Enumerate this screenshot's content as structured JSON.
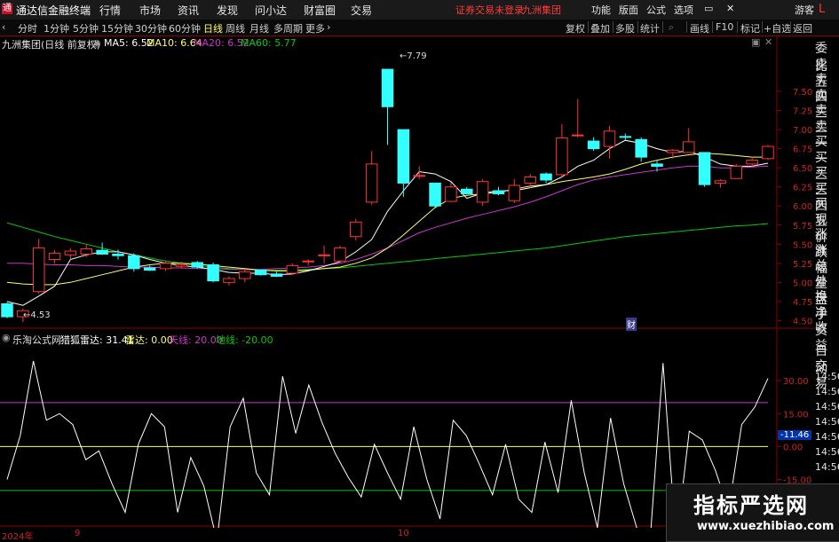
{
  "menubar": {
    "brand": "通达信金融终端",
    "items": [
      "行情",
      "市场",
      "资讯",
      "发现",
      "问小达",
      "财富圈",
      "交易"
    ],
    "login_status": "证券交易未登录",
    "group_name": "九洲集团",
    "right_items": [
      "功能",
      "版面",
      "公式",
      "选项"
    ],
    "guest": "游客"
  },
  "toolbar": {
    "periods": [
      "分时",
      "1分钟",
      "5分钟",
      "15分钟",
      "30分钟",
      "60分钟",
      "日线",
      "周线",
      "月线",
      "多周期",
      "更多"
    ],
    "active": "日线",
    "right_items": [
      "复权",
      "叠加",
      "多股",
      "统计",
      "画线",
      "F10",
      "标记",
      "+自选",
      "返回"
    ]
  },
  "infobar": {
    "stock": "九洲集团(日线 前复权)",
    "ma5": "MA5: 6.52",
    "ma10": "MA10: 6.64",
    "ma20": "MA20: 6.52",
    "ma60": "MA60: 5.77"
  },
  "indicator_bar": {
    "source": "乐淘公式网",
    "name": "猎狐雷达: 31.41",
    "radar": "雷达: 0.00",
    "sky": "天线: 20.00",
    "ground": "地线: -20.00"
  },
  "right_panel": [
    "委比",
    "卖五",
    "卖四",
    "卖三",
    "卖二",
    "卖一",
    "买一",
    "买二",
    "买三",
    "买四",
    "买五",
    "现价",
    "涨跌",
    "涨幅",
    "总量",
    "外盘",
    "换手",
    "净资",
    "收益"
  ],
  "right_panel2": [
    "自动",
    "交易"
  ],
  "right_times": [
    "14:56",
    "14:56",
    "14:56",
    "14:56",
    "14:56",
    "14:56",
    "14:56"
  ],
  "corner_label": "L",
  "price_annotations": {
    "high": "7.79",
    "low": "4.53",
    "cai": "财"
  },
  "x_labels": [
    "2024年",
    "9",
    "10"
  ],
  "watermark": {
    "title": "指标严选网",
    "url": "www.xuezhibiao.com"
  },
  "chart_data": {
    "type": "candlestick",
    "price_axis": {
      "ticks": [
        "7.50",
        "7.25",
        "7.00",
        "6.75",
        "6.50",
        "6.25",
        "6.00",
        "5.75",
        "5.50",
        "5.25",
        "5.00",
        "4.75",
        "4.50"
      ],
      "range": [
        4.4,
        8.0
      ]
    },
    "indicator_axis": {
      "ticks": [
        "30.00",
        "15.00",
        "0.00",
        "-15.00",
        "-30.00"
      ],
      "range": [
        -35,
        45
      ],
      "current": "-11.46",
      "sky": 20,
      "ground": -20,
      "radar": 0
    },
    "colors": {
      "up": "#ff3333",
      "down": "#33ffff",
      "ma5": "#ffffff",
      "ma10": "#ffff66",
      "ma20": "#cc33cc",
      "ma60": "#00cc00"
    },
    "candles": [
      {
        "o": 4.72,
        "h": 4.74,
        "l": 4.53,
        "c": 4.55
      },
      {
        "o": 4.55,
        "h": 4.66,
        "l": 4.48,
        "c": 4.63
      },
      {
        "o": 4.88,
        "h": 5.57,
        "l": 4.85,
        "c": 5.45
      },
      {
        "o": 5.3,
        "h": 5.42,
        "l": 5.25,
        "c": 5.38
      },
      {
        "o": 5.36,
        "h": 5.45,
        "l": 5.3,
        "c": 5.41
      },
      {
        "o": 5.37,
        "h": 5.5,
        "l": 5.33,
        "c": 5.44
      },
      {
        "o": 5.42,
        "h": 5.52,
        "l": 5.36,
        "c": 5.37
      },
      {
        "o": 5.37,
        "h": 5.43,
        "l": 5.3,
        "c": 5.35
      },
      {
        "o": 5.35,
        "h": 5.38,
        "l": 5.14,
        "c": 5.18
      },
      {
        "o": 5.19,
        "h": 5.22,
        "l": 5.15,
        "c": 5.16
      },
      {
        "o": 5.18,
        "h": 5.28,
        "l": 5.15,
        "c": 5.25
      },
      {
        "o": 5.21,
        "h": 5.27,
        "l": 5.18,
        "c": 5.23
      },
      {
        "o": 5.26,
        "h": 5.28,
        "l": 5.18,
        "c": 5.2
      },
      {
        "o": 5.23,
        "h": 5.26,
        "l": 5.0,
        "c": 5.02
      },
      {
        "o": 5.0,
        "h": 5.08,
        "l": 4.96,
        "c": 5.05
      },
      {
        "o": 5.05,
        "h": 5.18,
        "l": 5.0,
        "c": 5.14
      },
      {
        "o": 5.16,
        "h": 5.17,
        "l": 5.09,
        "c": 5.1
      },
      {
        "o": 5.11,
        "h": 5.14,
        "l": 5.07,
        "c": 5.08
      },
      {
        "o": 5.12,
        "h": 5.25,
        "l": 5.1,
        "c": 5.22
      },
      {
        "o": 5.27,
        "h": 5.3,
        "l": 5.22,
        "c": 5.28
      },
      {
        "o": 5.36,
        "h": 5.48,
        "l": 5.25,
        "c": 5.36
      },
      {
        "o": 5.28,
        "h": 5.48,
        "l": 5.27,
        "c": 5.45
      },
      {
        "o": 5.6,
        "h": 5.83,
        "l": 5.55,
        "c": 5.79
      },
      {
        "o": 6.05,
        "h": 6.72,
        "l": 6.02,
        "c": 6.55
      },
      {
        "o": 7.79,
        "h": 7.79,
        "l": 6.8,
        "c": 7.3
      },
      {
        "o": 7.0,
        "h": 7.0,
        "l": 6.12,
        "c": 6.3
      },
      {
        "o": 6.4,
        "h": 6.52,
        "l": 6.35,
        "c": 6.4
      },
      {
        "o": 6.3,
        "h": 6.3,
        "l": 5.97,
        "c": 6.0
      },
      {
        "o": 6.06,
        "h": 6.31,
        "l": 6.05,
        "c": 6.25
      },
      {
        "o": 6.22,
        "h": 6.25,
        "l": 6.15,
        "c": 6.16
      },
      {
        "o": 6.05,
        "h": 6.35,
        "l": 6.0,
        "c": 6.32
      },
      {
        "o": 6.2,
        "h": 6.25,
        "l": 6.14,
        "c": 6.16
      },
      {
        "o": 6.07,
        "h": 6.35,
        "l": 6.04,
        "c": 6.27
      },
      {
        "o": 6.3,
        "h": 6.42,
        "l": 6.24,
        "c": 6.38
      },
      {
        "o": 6.42,
        "h": 6.44,
        "l": 6.3,
        "c": 6.34
      },
      {
        "o": 6.41,
        "h": 7.07,
        "l": 6.38,
        "c": 6.89
      },
      {
        "o": 6.93,
        "h": 7.4,
        "l": 6.9,
        "c": 6.93
      },
      {
        "o": 6.85,
        "h": 6.9,
        "l": 6.72,
        "c": 6.75
      },
      {
        "o": 6.78,
        "h": 7.05,
        "l": 6.62,
        "c": 6.98
      },
      {
        "o": 6.91,
        "h": 6.95,
        "l": 6.86,
        "c": 6.9
      },
      {
        "o": 6.87,
        "h": 6.9,
        "l": 6.58,
        "c": 6.64
      },
      {
        "o": 6.55,
        "h": 6.59,
        "l": 6.45,
        "c": 6.52
      },
      {
        "o": 6.7,
        "h": 6.75,
        "l": 6.62,
        "c": 6.73
      },
      {
        "o": 6.7,
        "h": 7.02,
        "l": 6.7,
        "c": 6.84
      },
      {
        "o": 6.7,
        "h": 6.7,
        "l": 6.25,
        "c": 6.28
      },
      {
        "o": 6.3,
        "h": 6.35,
        "l": 6.24,
        "c": 6.33
      },
      {
        "o": 6.36,
        "h": 6.55,
        "l": 6.35,
        "c": 6.52
      },
      {
        "o": 6.55,
        "h": 6.65,
        "l": 6.5,
        "c": 6.6
      },
      {
        "o": 6.62,
        "h": 6.8,
        "l": 6.6,
        "c": 6.78
      }
    ],
    "ma5": [
      4.75,
      4.7,
      4.82,
      4.95,
      5.3,
      5.36,
      5.4,
      5.4,
      5.36,
      5.3,
      5.25,
      5.22,
      5.2,
      5.17,
      5.13,
      5.12,
      5.12,
      5.1,
      5.11,
      5.15,
      5.21,
      5.27,
      5.4,
      5.56,
      5.93,
      6.2,
      6.45,
      6.42,
      6.32,
      6.1,
      6.17,
      6.2,
      6.2,
      6.24,
      6.28,
      6.38,
      6.52,
      6.6,
      6.75,
      6.86,
      6.82,
      6.75,
      6.7,
      6.72,
      6.64,
      6.55,
      6.52,
      6.52,
      6.56
    ],
    "ma10": [
      5.0,
      4.98,
      4.97,
      4.97,
      5.0,
      5.05,
      5.1,
      5.15,
      5.2,
      5.23,
      5.25,
      5.25,
      5.24,
      5.22,
      5.2,
      5.18,
      5.16,
      5.15,
      5.15,
      5.16,
      5.18,
      5.2,
      5.25,
      5.32,
      5.45,
      5.62,
      5.8,
      5.98,
      6.1,
      6.14,
      6.16,
      6.18,
      6.22,
      6.26,
      6.28,
      6.32,
      6.35,
      6.38,
      6.42,
      6.48,
      6.55,
      6.6,
      6.64,
      6.67,
      6.69,
      6.68,
      6.66,
      6.64,
      6.64
    ],
    "ma20": [
      5.25,
      5.25,
      5.24,
      5.23,
      5.23,
      5.22,
      5.22,
      5.21,
      5.2,
      5.2,
      5.19,
      5.19,
      5.18,
      5.18,
      5.17,
      5.17,
      5.17,
      5.18,
      5.19,
      5.2,
      5.22,
      5.25,
      5.3,
      5.37,
      5.45,
      5.55,
      5.65,
      5.72,
      5.78,
      5.84,
      5.89,
      5.94,
      5.99,
      6.05,
      6.12,
      6.2,
      6.28,
      6.34,
      6.38,
      6.41,
      6.44,
      6.47,
      6.5,
      6.52,
      6.52,
      6.5,
      6.5,
      6.51,
      6.52
    ],
    "ma60": [
      5.78,
      5.72,
      5.66,
      5.6,
      5.55,
      5.5,
      5.45,
      5.4,
      5.36,
      5.32,
      5.28,
      5.25,
      5.22,
      5.2,
      5.18,
      5.17,
      5.16,
      5.16,
      5.16,
      5.17,
      5.18,
      5.19,
      5.21,
      5.23,
      5.25,
      5.27,
      5.29,
      5.31,
      5.33,
      5.35,
      5.37,
      5.39,
      5.41,
      5.43,
      5.45,
      5.48,
      5.51,
      5.54,
      5.57,
      5.6,
      5.62,
      5.64,
      5.66,
      5.68,
      5.7,
      5.72,
      5.74,
      5.75,
      5.77
    ],
    "radar_series": [
      -15,
      5,
      39,
      12,
      15,
      10,
      -6,
      -2,
      -17,
      -30,
      1,
      15,
      9,
      -30,
      -5,
      -18,
      -43,
      9,
      22,
      -12,
      -22,
      32,
      6,
      28,
      11,
      -3,
      -14,
      -23,
      1,
      -12,
      -24,
      9,
      -15,
      -33,
      12,
      5,
      -8,
      -22,
      1,
      -24,
      -30,
      2,
      -21,
      21,
      -12,
      -37,
      13,
      -17,
      -37,
      -44,
      38,
      -44,
      7,
      3,
      -11,
      -29,
      10,
      18,
      31
    ]
  }
}
